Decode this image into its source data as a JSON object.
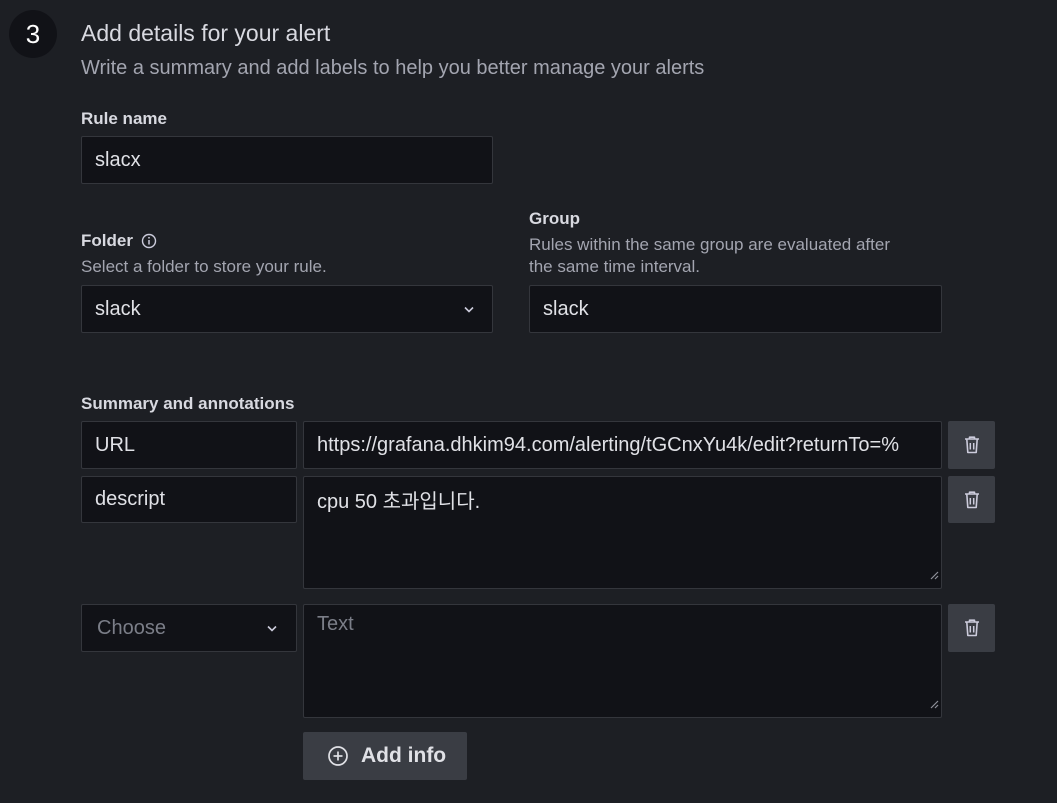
{
  "step": {
    "number": "3",
    "title": "Add details for your alert",
    "subtitle": "Write a summary and add labels to help you better manage your alerts"
  },
  "rule_name": {
    "label": "Rule name",
    "value": "slacx"
  },
  "folder": {
    "label": "Folder",
    "description": "Select a folder to store your rule.",
    "value": "slack",
    "info_icon": "info-icon"
  },
  "group": {
    "label": "Group",
    "description_line1": "Rules within the same group are evaluated after",
    "description_line2": "the same time interval.",
    "value": "slack"
  },
  "annotations": {
    "label": "Summary and annotations",
    "rows": [
      {
        "key": "URL",
        "value": "https://grafana.dhkim94.com/alerting/tGCnxYu4k/edit?returnTo=%"
      },
      {
        "key": "descript",
        "value": "cpu 50 초과입니다."
      }
    ],
    "new_row": {
      "key_placeholder": "Choose",
      "value_placeholder": "Text"
    },
    "add_button": "Add info"
  },
  "colors": {
    "background": "#1d1f24",
    "input_bg": "#111217",
    "button_bg": "#3a3d44"
  }
}
